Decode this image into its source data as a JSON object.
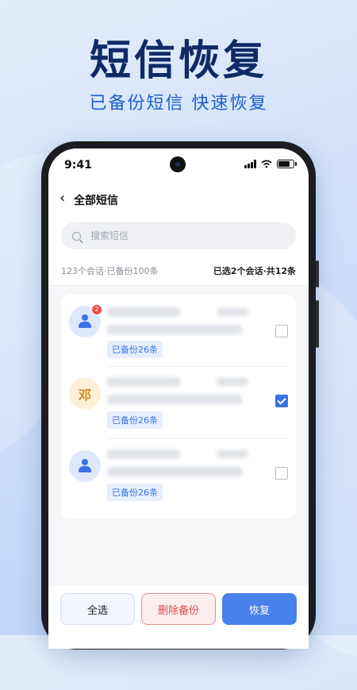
{
  "promo": {
    "headline": "短信恢复",
    "subline": "已备份短信 快速恢复"
  },
  "status_bar": {
    "time": "9:41"
  },
  "nav": {
    "back_icon": "chevron-left-icon",
    "title": "全部短信"
  },
  "search": {
    "placeholder": "搜索短信"
  },
  "summary": {
    "left": "123个会话·已备份100条",
    "right": "已选2个会话·共12条"
  },
  "conversations": [
    {
      "avatar_type": "person-icon",
      "avatar_text": "",
      "unread": "2",
      "backup_tag": "已备份26条",
      "checked": false
    },
    {
      "avatar_type": "name",
      "avatar_text": "邓",
      "unread": "",
      "backup_tag": "已备份26条",
      "checked": true
    },
    {
      "avatar_type": "person-icon",
      "avatar_text": "",
      "unread": "",
      "backup_tag": "已备份26条",
      "checked": false
    }
  ],
  "actions": {
    "select_all": "全选",
    "delete_backup": "删除备份",
    "restore": "恢复"
  },
  "colors": {
    "accent": "#4a80ec",
    "danger": "#e04848",
    "headline": "#0f2a66"
  }
}
